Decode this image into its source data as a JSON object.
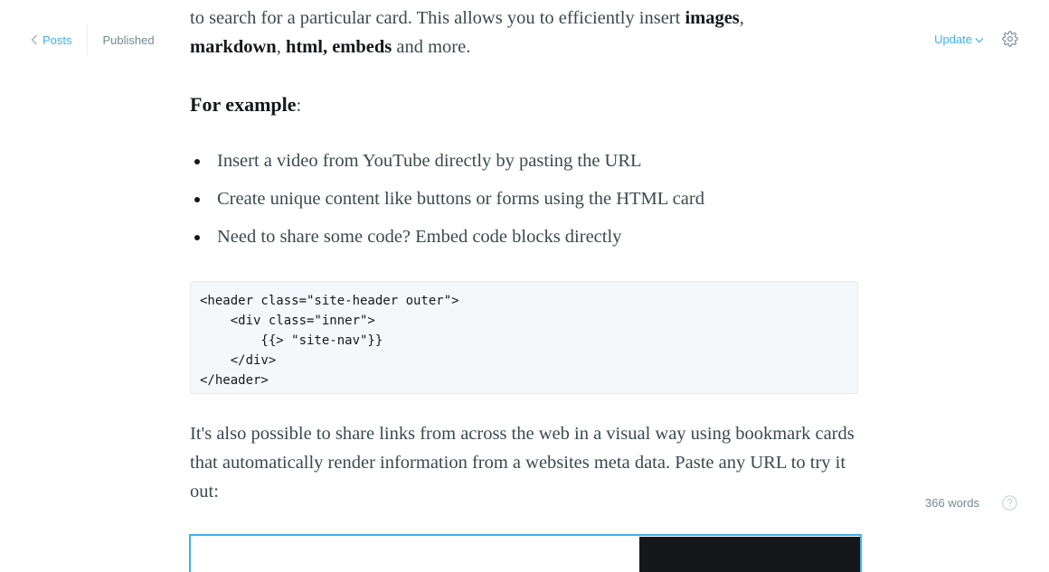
{
  "topbar": {
    "back_label": "Posts",
    "status": "Published",
    "update_label": "Update"
  },
  "icons": {
    "back": "chevron-left-icon",
    "update_dropdown": "chevron-down-icon",
    "settings": "gear-icon",
    "help": "question-circle-icon"
  },
  "colors": {
    "accent": "#3eb0ef",
    "muted": "#738a94",
    "text": "#3c484e",
    "code_bg": "#f5f8fa"
  },
  "content": {
    "p1": {
      "text_a": "to search for a particular card. This allows you to efficiently insert ",
      "bold_1": "images",
      "text_b": ",",
      "bold_2": "markdown",
      "text_c": ", ",
      "bold_3": "html, embeds",
      "text_d": " and more."
    },
    "p2": {
      "bold": "For example",
      "colon": ":"
    },
    "bullets": [
      "Insert a video from YouTube directly by pasting the URL",
      "Create unique content like buttons or forms using the HTML card",
      "Need to share some code? Embed code blocks directly"
    ],
    "code_lines": [
      "<header class=\"site-header outer\">",
      "    <div class=\"inner\">",
      "        {{> \"site-nav\"}}",
      "    </div>",
      "</header>"
    ],
    "p3": "It's also possible to share links from across the web in a visual way using bookmark cards that automatically render information from a websites meta data. Paste any URL to try it out:"
  },
  "footer": {
    "word_count": "366 words"
  }
}
